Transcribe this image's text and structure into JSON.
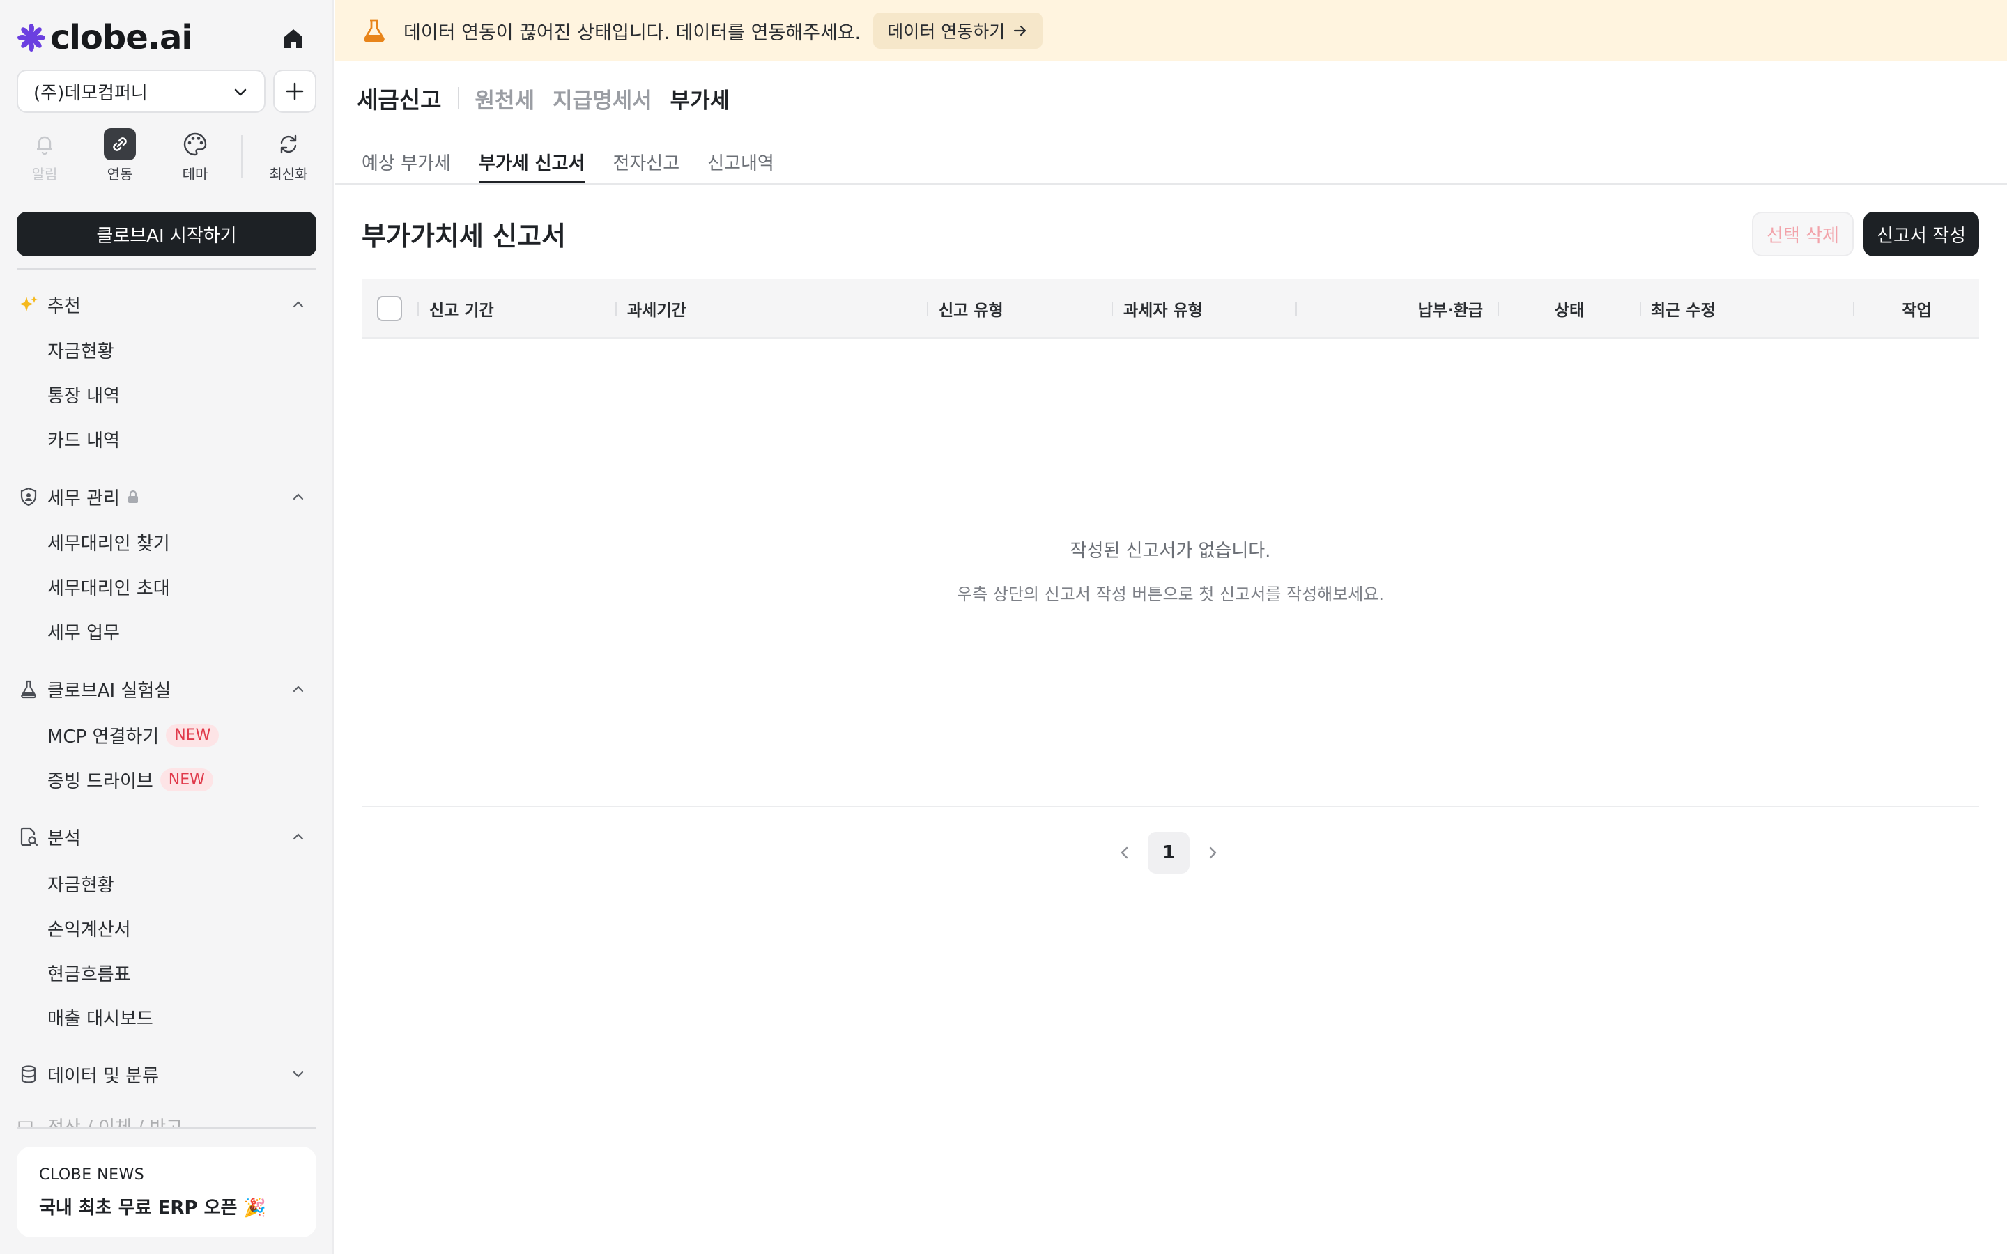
{
  "brand": {
    "logo_text": "clobe.ai"
  },
  "sidebar": {
    "company": "(주)데모컴퍼니",
    "quick_actions": [
      {
        "label": "알림",
        "icon": "bell-icon"
      },
      {
        "label": "연동",
        "icon": "link-icon"
      },
      {
        "label": "테마",
        "icon": "palette-icon"
      },
      {
        "label": "최신화",
        "icon": "refresh-icon"
      }
    ],
    "start_button": "클로브AI 시작하기",
    "sections": [
      {
        "title": "추천",
        "icon": "sparkle-icon",
        "items": [
          "자금현황",
          "통장 내역",
          "카드 내역"
        ]
      },
      {
        "title": "세무 관리",
        "icon": "shield-icon",
        "locked": true,
        "items": [
          "세무대리인 찾기",
          "세무대리인 초대",
          "세무 업무"
        ]
      },
      {
        "title": "클로브AI 실험실",
        "icon": "flask-icon",
        "items": [
          {
            "label": "MCP 연결하기",
            "badge": "NEW"
          },
          {
            "label": "증빙 드라이브",
            "badge": "NEW"
          }
        ]
      },
      {
        "title": "분석",
        "icon": "document-search-icon",
        "items": [
          "자금현황",
          "손익계산서",
          "현금흐름표",
          "매출 대시보드"
        ]
      },
      {
        "title": "데이터 및 분류",
        "icon": "database-icon",
        "collapsed": true,
        "items": []
      }
    ],
    "faded_item": "정산 / 이체 / 반고",
    "news": {
      "tag": "CLOBE NEWS",
      "title": "국내 최초 무료 ERP 오픈 🎉"
    }
  },
  "banner": {
    "message": "데이터 연동이 끊어진 상태입니다. 데이터를 연동해주세요.",
    "button": "데이터 연동하기"
  },
  "breadcrumb": {
    "root": "세금신고",
    "items": [
      "원천세",
      "지급명세서",
      "부가세"
    ],
    "active_index": 2
  },
  "tabs": [
    {
      "label": "예상 부가세",
      "active": false
    },
    {
      "label": "부가세 신고서",
      "active": true
    },
    {
      "label": "전자신고",
      "active": false
    },
    {
      "label": "신고내역",
      "active": false
    }
  ],
  "page": {
    "title": "부가가치세 신고서",
    "delete_button": "선택 삭제",
    "create_button": "신고서 작성"
  },
  "table": {
    "columns": [
      "신고 기간",
      "과세기간",
      "신고 유형",
      "과세자 유형",
      "납부·환급",
      "상태",
      "최근 수정",
      "작업"
    ],
    "rows": [],
    "empty_title": "작성된 신고서가 없습니다.",
    "empty_desc": "우측 상단의 신고서 작성 버튼으로 첫 신고서를 작성해보세요."
  },
  "pagination": {
    "current": "1"
  },
  "colors": {
    "banner_bg": "#fff4df",
    "primary_dark": "#1d2125",
    "badge_red": "#e03a4b",
    "logo_purple": "#6b3fe0"
  }
}
